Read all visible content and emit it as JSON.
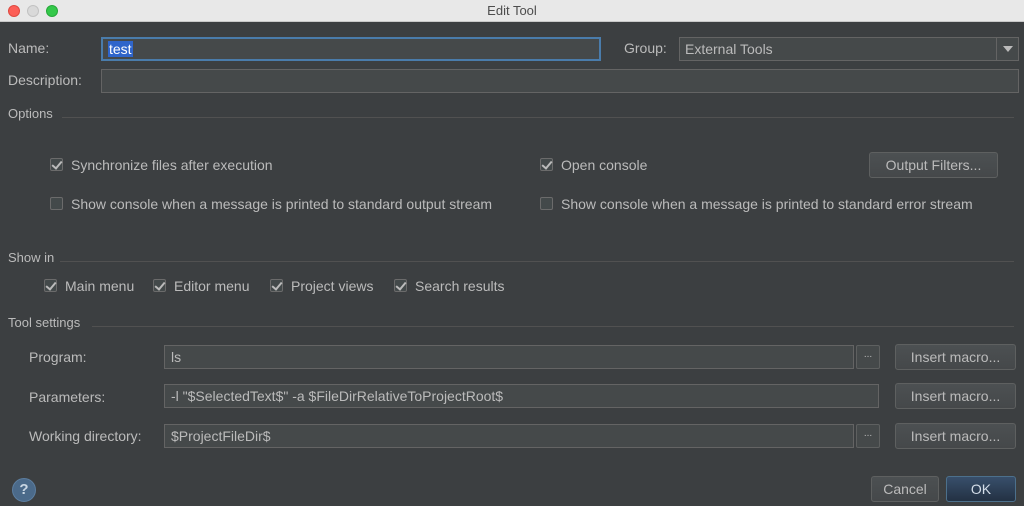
{
  "window": {
    "title": "Edit Tool"
  },
  "name": {
    "label": "Name:",
    "value": "test"
  },
  "group": {
    "label": "Group:",
    "value": "External Tools"
  },
  "description": {
    "label": "Description:",
    "value": ""
  },
  "options": {
    "heading": "Options",
    "sync_files": {
      "label": "Synchronize files after execution",
      "checked": true
    },
    "open_console": {
      "label": "Open console",
      "checked": true
    },
    "output_filters_label": "Output Filters...",
    "show_console_stdout": {
      "label": "Show console when a message is printed to standard output stream",
      "checked": false
    },
    "show_console_stderr": {
      "label": "Show console when a message is printed to standard error stream",
      "checked": false
    }
  },
  "show_in": {
    "heading": "Show in",
    "main_menu": {
      "label": "Main menu",
      "checked": true
    },
    "editor_menu": {
      "label": "Editor menu",
      "checked": true
    },
    "project_views": {
      "label": "Project views",
      "checked": true
    },
    "search_results": {
      "label": "Search results",
      "checked": true
    }
  },
  "tool_settings": {
    "heading": "Tool settings",
    "program": {
      "label": "Program:",
      "value": "ls"
    },
    "parameters": {
      "label": "Parameters:",
      "value": "-l \"$SelectedText$\" -a $FileDirRelativeToProjectRoot$"
    },
    "working_dir": {
      "label": "Working directory:",
      "value": "$ProjectFileDir$"
    },
    "browse_label": "...",
    "insert_macro_label": "Insert macro..."
  },
  "footer": {
    "help_label": "?",
    "cancel_label": "Cancel",
    "ok_label": "OK"
  },
  "colors": {
    "background": "#3c3f41",
    "focus": "#4a7cab",
    "selection": "#2f65ca",
    "default_button": "#2d4156"
  }
}
